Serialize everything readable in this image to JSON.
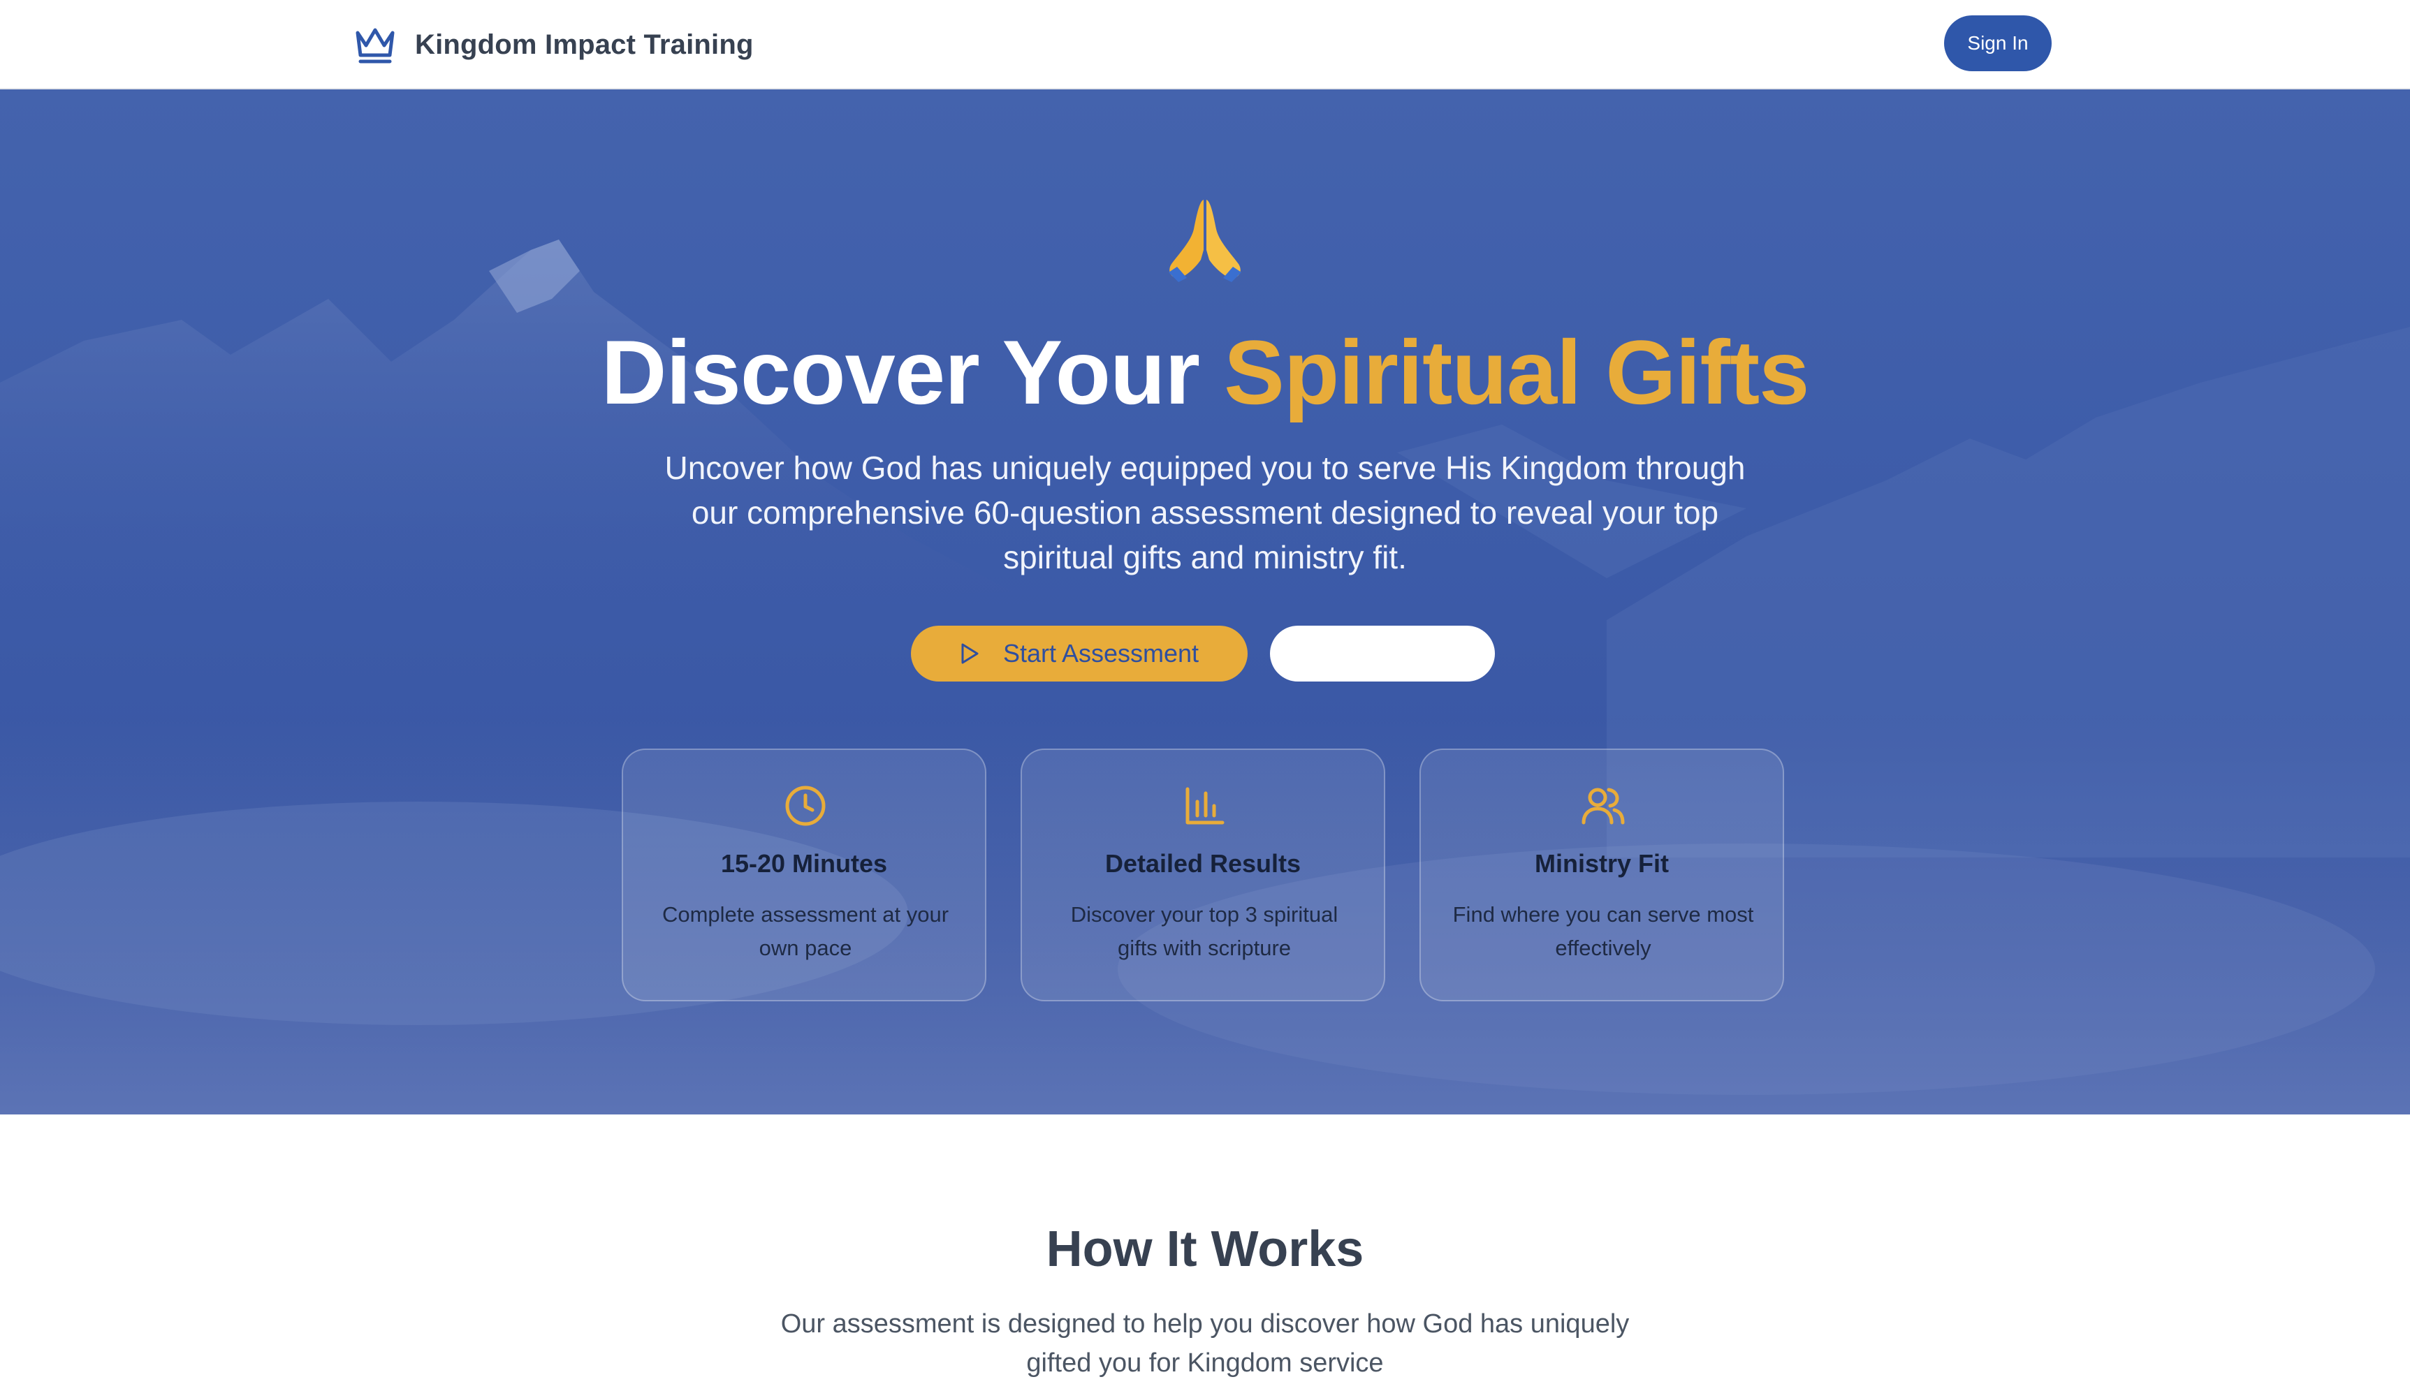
{
  "header": {
    "brand_name": "Kingdom Impact Training",
    "brand_icon": "crown-icon",
    "sign_in_label": "Sign In"
  },
  "hero": {
    "icon": "praying-hands-icon",
    "title_part1": "Discover Your ",
    "title_accent": "Spiritual Gifts",
    "subtitle": "Uncover how God has uniquely equipped you to serve His Kingdom through our comprehensive 60-question assessment designed to reveal your top spiritual gifts and ministry fit.",
    "start_button_label": "Start Assessment",
    "secondary_button_label": ""
  },
  "features": [
    {
      "icon": "clock-icon",
      "title": "15-20 Minutes",
      "description": "Complete assessment at your own pace"
    },
    {
      "icon": "bar-chart-icon",
      "title": "Detailed Results",
      "description": "Discover your top 3 spiritual gifts with scripture"
    },
    {
      "icon": "users-icon",
      "title": "Ministry Fit",
      "description": "Find where you can serve most effectively"
    }
  ],
  "how_it_works": {
    "title": "How It Works",
    "subtitle": "Our assessment is designed to help you discover how God has uniquely gifted you for Kingdom service"
  },
  "colors": {
    "primary": "#2f57aa",
    "accent": "#e8ac3a",
    "hero_overlay": "#3d5ca9"
  }
}
